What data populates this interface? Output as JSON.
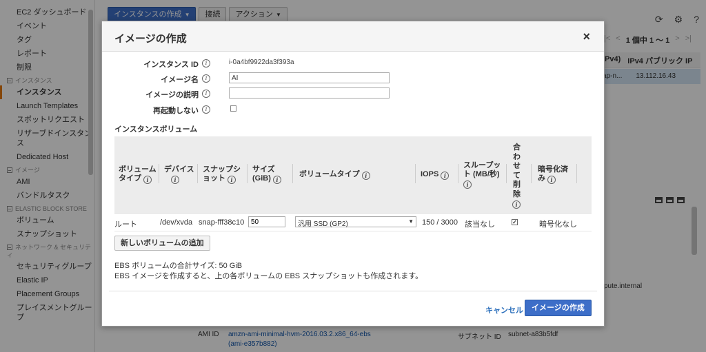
{
  "sidebar": {
    "items": [
      {
        "type": "item",
        "label": "EC2 ダッシュボード"
      },
      {
        "type": "item",
        "label": "イベント"
      },
      {
        "type": "item",
        "label": "タグ"
      },
      {
        "type": "item",
        "label": "レポート"
      },
      {
        "type": "item",
        "label": "制限"
      },
      {
        "type": "section",
        "label": "インスタンス"
      },
      {
        "type": "item",
        "label": "インスタンス",
        "active": true
      },
      {
        "type": "item",
        "label": "Launch Templates"
      },
      {
        "type": "item",
        "label": "スポットリクエスト"
      },
      {
        "type": "item",
        "label": "リザーブドインスタンス"
      },
      {
        "type": "item",
        "label": "Dedicated Host"
      },
      {
        "type": "section",
        "label": "イメージ"
      },
      {
        "type": "item",
        "label": "AMI"
      },
      {
        "type": "item",
        "label": "バンドルタスク"
      },
      {
        "type": "section",
        "label": "ELASTIC BLOCK STORE"
      },
      {
        "type": "item",
        "label": "ボリューム"
      },
      {
        "type": "item",
        "label": "スナップショット"
      },
      {
        "type": "section",
        "label": "ネットワーク & セキュリティ"
      },
      {
        "type": "item",
        "label": "セキュリティグループ"
      },
      {
        "type": "item",
        "label": "Elastic IP"
      },
      {
        "type": "item",
        "label": "Placement Groups"
      },
      {
        "type": "item",
        "label": "プレイスメントグループ"
      }
    ]
  },
  "toolbar": {
    "launch_label": "インスタンスの作成",
    "connect_label": "接続",
    "actions_label": "アクション"
  },
  "pager": {
    "text": "1 個中 1 ～ 1"
  },
  "grid": {
    "col1": "IPv4)",
    "col2": "IPv4 パブリック IP",
    "row_col1": "ap-n...",
    "row_col2": "13.112.16.43"
  },
  "details": {
    "hostname_fragment": "pute.internal",
    "ami_label": "AMI ID",
    "ami_value": "amzn-ami-minimal-hvm-2016.03.2.x86_64-ebs",
    "ami_value2": "(ami-e357b882)",
    "subnet_label": "サブネット ID",
    "subnet_value": "subnet-a83b5fdf"
  },
  "modal": {
    "title": "イメージの作成",
    "close": "×",
    "fields": {
      "instance_id_label": "インスタンス ID",
      "instance_id_value": "i-0a4bf9922da3f393a",
      "image_name_label": "イメージ名",
      "image_name_value": "AI",
      "image_desc_label": "イメージの説明",
      "image_desc_value": "",
      "no_reboot_label": "再起動しない"
    },
    "volumes_title": "インスタンスボリューム",
    "columns": {
      "volume_type": "ボリューム タイプ",
      "device": "デバイス",
      "snapshot": "スナップシ ョット",
      "size": "サイズ (GiB)",
      "vol_type": "ボリュームタイプ",
      "iops": "IOPS",
      "throughput": "スループッ ト (MB/秒)",
      "delete_on_term": "合わせて削除",
      "encrypted": "暗号化済 み"
    },
    "row": {
      "volume_type": "ルート",
      "device": "/dev/xvda",
      "snapshot": "snap-fff38c10",
      "size": "50",
      "vol_type": "汎用 SSD (GP2)",
      "iops": "150 / 3000",
      "throughput": "該当なし",
      "delete_on_term": true,
      "encrypted": "暗号化なし"
    },
    "add_volume_label": "新しいボリュームの追加",
    "total_size_text": "EBS ボリュームの合計サイズ: 50 GiB",
    "note_text": "EBS イメージを作成すると、上の各ボリュームの EBS スナップショットも作成されます。",
    "cancel_label": "キャンセル",
    "create_label": "イメージの作成"
  },
  "colors": {
    "primary_button": "#3d6ec8",
    "link": "#2a6ebb",
    "active_marker": "#e47911",
    "selected_row": "#d5e6f4"
  }
}
